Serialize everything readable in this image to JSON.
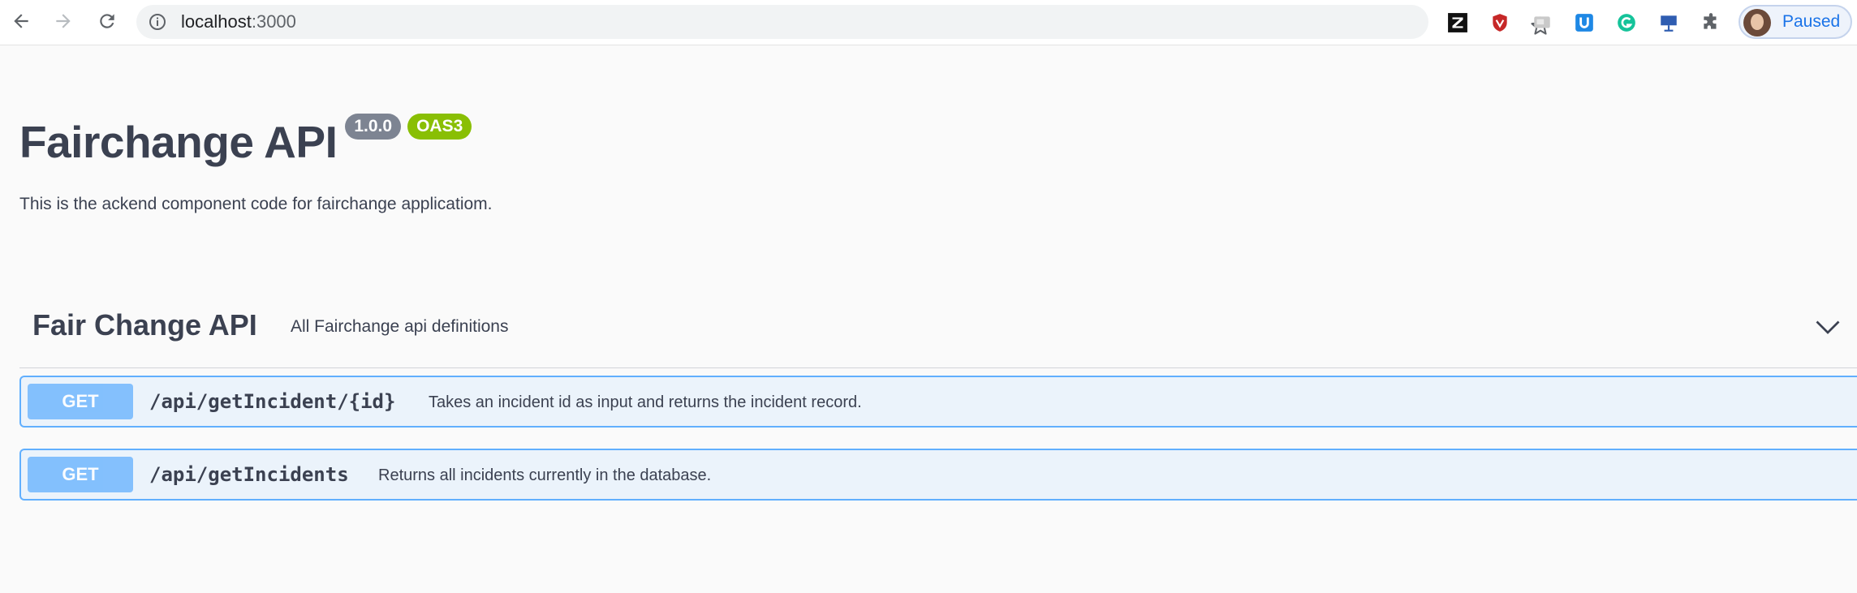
{
  "browser": {
    "url_host": "localhost",
    "url_port": ":3000",
    "profile_label": "Paused",
    "extensions": [
      "zotero-icon",
      "shield-extension-icon",
      "screen-capture-icon",
      "u-extension-icon",
      "grammarly-icon",
      "presentation-icon",
      "puzzle-extensions-icon"
    ]
  },
  "api": {
    "title": "Fairchange API",
    "version": "1.0.0",
    "spec": "OAS3",
    "description": "This is the ackend component code for fairchange applicatiom."
  },
  "tag": {
    "name": "Fair Change API",
    "description": "All Fairchange api definitions"
  },
  "operations": [
    {
      "method": "GET",
      "path": "/api/getIncident/{id}",
      "summary": "Takes an incident id as input and returns the incident record."
    },
    {
      "method": "GET",
      "path": "/api/getIncidents",
      "summary": "Returns all incidents currently in the database."
    }
  ],
  "colors": {
    "get_method": "#61affe",
    "version_badge": "#7d8492",
    "oas_badge": "#89bf04"
  }
}
